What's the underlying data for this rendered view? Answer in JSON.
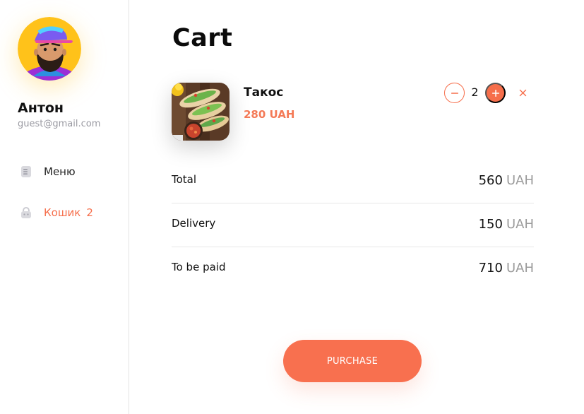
{
  "user": {
    "name": "Антон",
    "email": "guest@gmail.com",
    "avatar_icon": "avatar-icon"
  },
  "nav": {
    "menu": {
      "label": "Меню",
      "icon": "menu-icon"
    },
    "cart": {
      "label": "Кошик",
      "count": "2",
      "icon": "basket-icon"
    }
  },
  "page": {
    "title": "Cart"
  },
  "cart_item": {
    "name": "Такос",
    "price": "280 UAH",
    "quantity": "2",
    "minus_icon": "minus-icon",
    "plus_icon": "plus-icon",
    "remove_icon": "close-icon"
  },
  "summary": [
    {
      "label": "Total",
      "amount": "560",
      "currency": "UAH"
    },
    {
      "label": "Delivery",
      "amount": "150",
      "currency": "UAH"
    },
    {
      "label": "To be paid",
      "amount": "710",
      "currency": "UAH"
    }
  ],
  "actions": {
    "purchase_label": "PURCHASE"
  },
  "colors": {
    "accent": "#f66e4b",
    "muted": "#9b9b9b",
    "divider": "#e6e6e6"
  }
}
